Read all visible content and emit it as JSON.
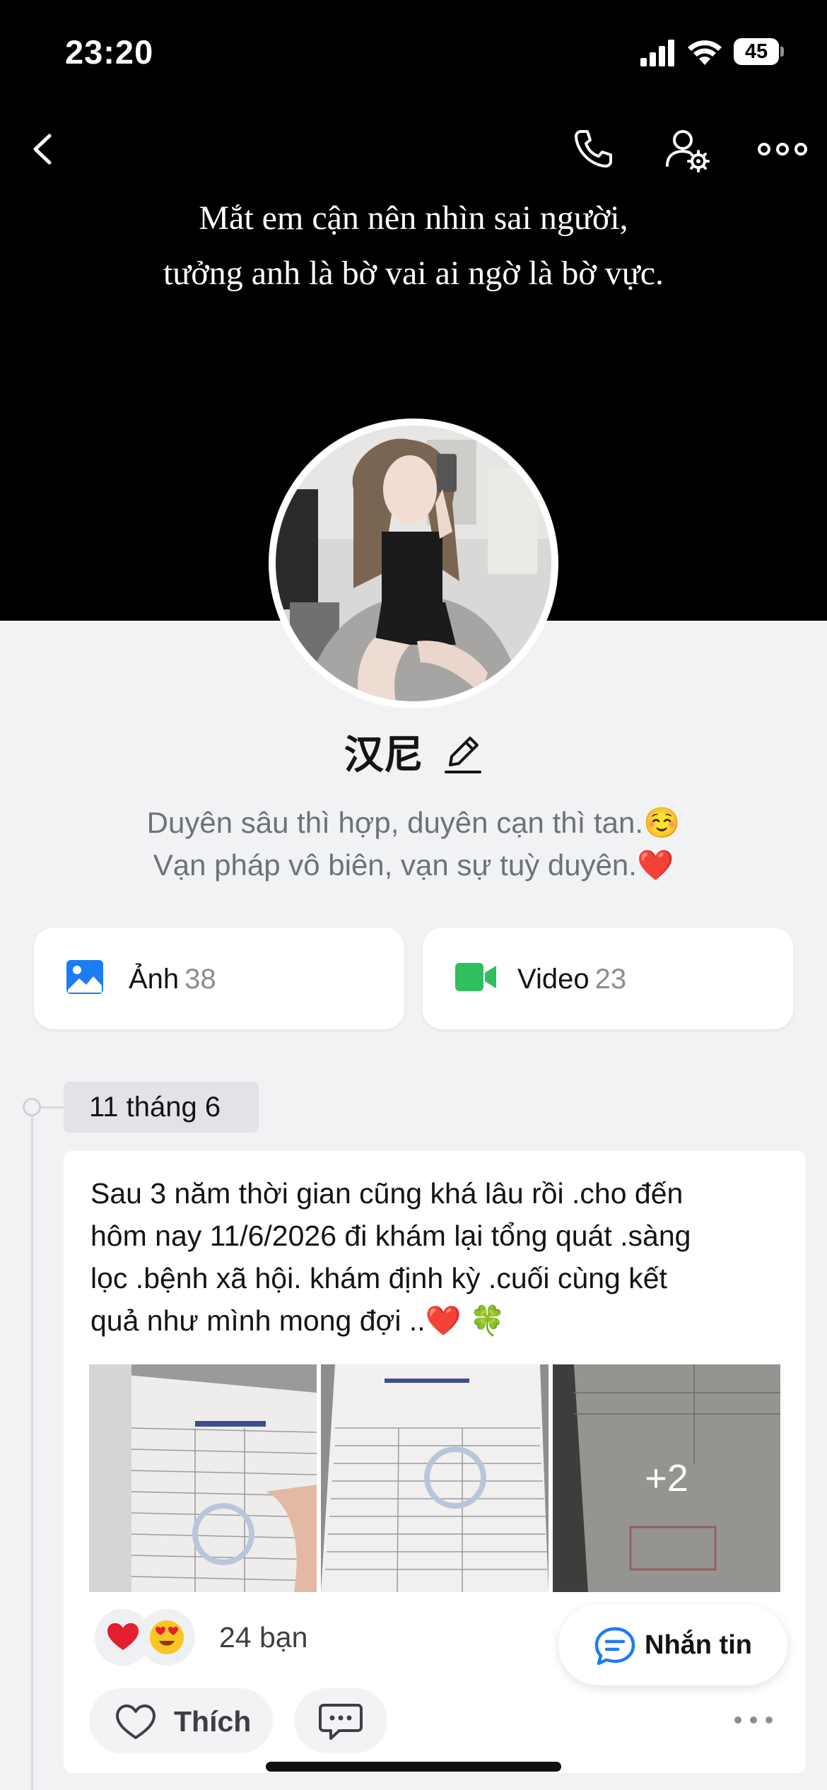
{
  "status_bar": {
    "time": "23:20",
    "battery": "45"
  },
  "cover": {
    "quote_lines": [
      "Mắt em cận nên nhìn sai người,",
      "tưởng anh là bờ vai ai ngờ là bờ vực."
    ]
  },
  "profile": {
    "name": "汉尼",
    "bio_lines": [
      "Duyên sâu thì hợp, duyên cạn thì tan.☺️",
      "Vạn pháp vô biên, vạn sự tuỳ duyên.❤️"
    ]
  },
  "media": {
    "photos_label": "Ảnh",
    "photos_count": "38",
    "videos_label": "Video",
    "videos_count": "23"
  },
  "timeline": {
    "date": "11 tháng 6"
  },
  "post": {
    "text_lines": [
      "Sau 3 năm thời gian cũng khá lâu rồi .cho đến",
      "hôm nay 11/6/2026 đi khám lại tổng quát .sàng",
      "lọc .bệnh xã hội. khám định kỳ .cuối cùng kết",
      "quả như mình mong đợi ..❤️ 🍀"
    ],
    "extra_images": "+2",
    "reaction_count": "24 bạn",
    "like_label": "Thích"
  },
  "message_button": {
    "label": "Nhắn tin"
  },
  "colors": {
    "accent_blue": "#1c7cf4",
    "video_green": "#2fbf5e",
    "cover_bg": "#000000",
    "page_bg": "#f1f2f4"
  },
  "icons": [
    "back-icon",
    "phone-icon",
    "profile-settings-icon",
    "more-icon",
    "edit-icon",
    "photo-icon",
    "video-icon",
    "heart-reaction-icon",
    "love-eyes-reaction-icon",
    "like-icon",
    "comment-icon",
    "message-icon"
  ]
}
